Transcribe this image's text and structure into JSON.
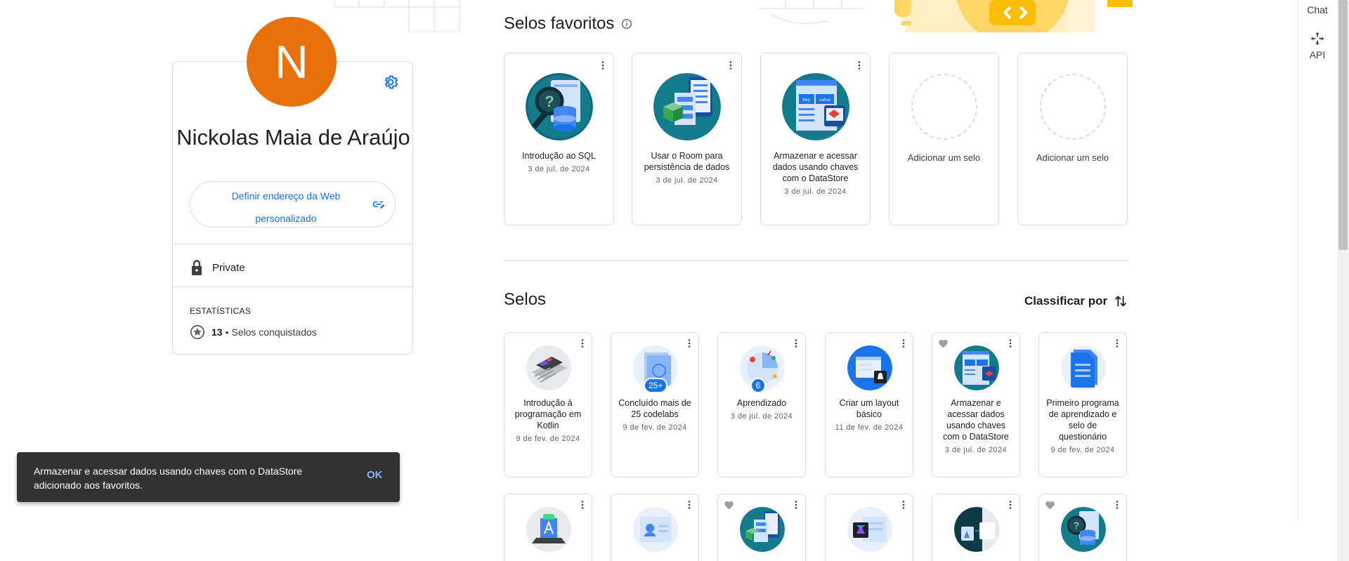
{
  "rail": {
    "chat_label": "Chat",
    "api_label": "API"
  },
  "profile": {
    "avatar_initial": "N",
    "avatar_color": "#e8710a",
    "name": "Nickolas Maia de Araújo",
    "custom_url_label": "Definir endereço da Web personalizado",
    "visibility": "Private",
    "stats_title": "ESTATÍSTICAS",
    "badges_count": "13",
    "badges_label": "• Selos conquistados"
  },
  "favorites": {
    "heading": "Selos favoritos",
    "cards": [
      {
        "title": "Introdução ao SQL",
        "date": "3 de jul. de 2024",
        "icon": "sql-badge"
      },
      {
        "title": "Usar o Room para persistência de dados",
        "date": "3 de jul. de 2024",
        "icon": "room-badge"
      },
      {
        "title": "Armazenar e acessar dados usando chaves com o DataStore",
        "date": "3 de jul. de 2024",
        "icon": "datastore-badge"
      },
      {
        "add_label": "Adicionar um selo"
      },
      {
        "add_label": "Adicionar um selo"
      }
    ]
  },
  "badges": {
    "heading": "Selos",
    "sort_label": "Classificar por",
    "row1": [
      {
        "title": "Introdução à programação em Kotlin",
        "date": "9 de fev. de 2024",
        "icon": "kotlin-badge"
      },
      {
        "title": "Concluído mais de 25 codelabs",
        "date": "9 de fev. de 2024",
        "icon": "codelabs-badge",
        "count": "25+"
      },
      {
        "title": "Aprendizado",
        "date": "3 de jul. de 2024",
        "icon": "learning-badge",
        "count": "6"
      },
      {
        "title": "Criar um layout básico",
        "date": "11 de fev. de 2024",
        "icon": "layout-badge"
      },
      {
        "title": "Armazenar e acessar dados usando chaves com o DataStore",
        "date": "3 de jul. de 2024",
        "icon": "datastore-badge",
        "favorite": true
      },
      {
        "title": "Primeiro programa de aprendizado e selo de questionário",
        "date": "9 de fev. de 2024",
        "icon": "quiz-badge"
      }
    ]
  },
  "snackbar": {
    "message": "Armazenar e acessar dados usando chaves com o DataStore adicionado aos favoritos.",
    "action": "OK"
  }
}
